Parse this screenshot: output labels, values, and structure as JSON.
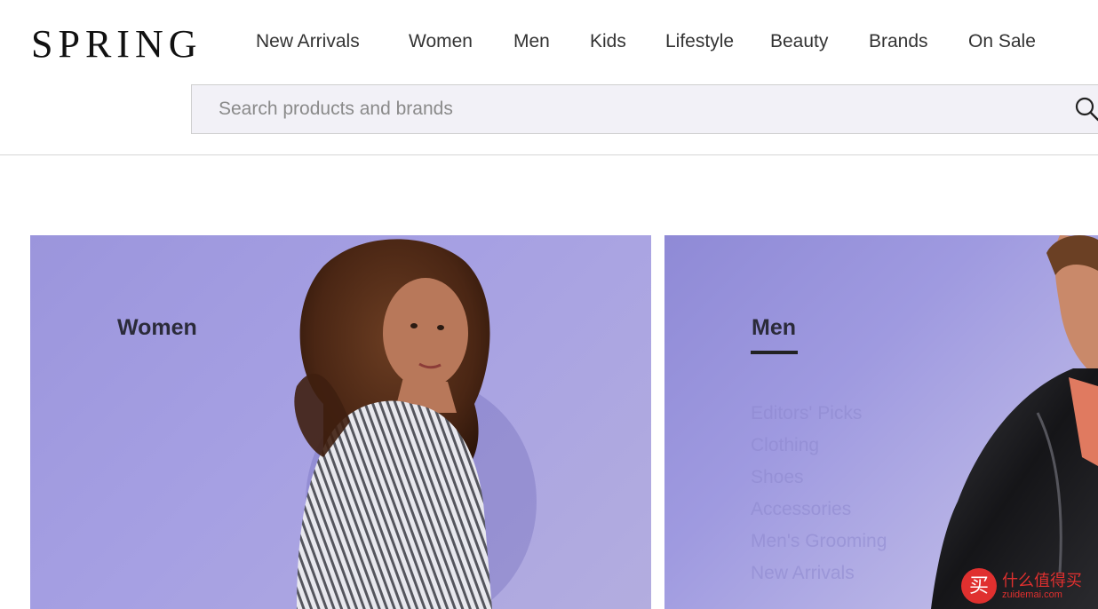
{
  "brand": {
    "logo": "SPRING"
  },
  "nav": {
    "items": [
      {
        "label": "New Arrivals"
      },
      {
        "label": "Women"
      },
      {
        "label": "Men"
      },
      {
        "label": "Kids"
      },
      {
        "label": "Lifestyle"
      },
      {
        "label": "Beauty"
      },
      {
        "label": "Brands"
      },
      {
        "label": "On Sale"
      }
    ]
  },
  "search": {
    "placeholder": "Search products and brands",
    "value": ""
  },
  "cards": {
    "women": {
      "title": "Women"
    },
    "men": {
      "title": "Men",
      "submenu": [
        "Editors' Picks",
        "Clothing",
        "Shoes",
        "Accessories",
        "Men's Grooming",
        "New Arrivals"
      ]
    }
  },
  "watermark": {
    "icon_text": "买",
    "text": "什么值得买",
    "subtext": "zuidemai.com"
  },
  "colors": {
    "accent": "#e0302f",
    "card_bg": "#9b95dc"
  }
}
